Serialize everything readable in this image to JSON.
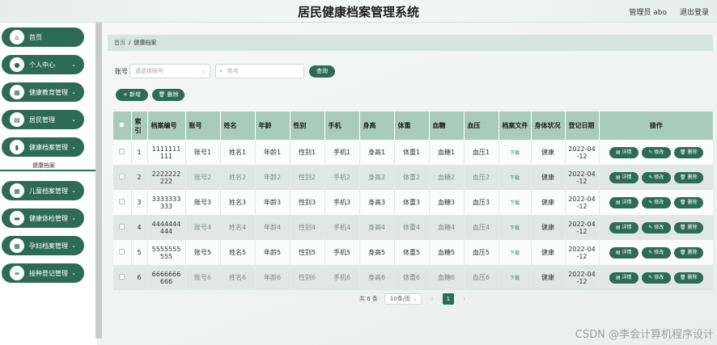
{
  "header": {
    "title": "居民健康档案管理系统",
    "user": "管理员 abo",
    "logout": "退出登录"
  },
  "sidebar": {
    "items": [
      {
        "label": "首页",
        "icon": "home-icon",
        "glyph": "⌂",
        "chevron": false
      },
      {
        "label": "个人中心",
        "icon": "user-icon",
        "glyph": "●",
        "chevron": true
      },
      {
        "label": "健康教育管理",
        "icon": "grid-icon",
        "glyph": "▦",
        "chevron": true
      },
      {
        "label": "居民管理",
        "icon": "doc-icon",
        "glyph": "▤",
        "chevron": true
      },
      {
        "label": "健康档案管理",
        "icon": "chart-icon",
        "glyph": "▮",
        "chevron": true
      },
      {
        "label": "儿童档案管理",
        "icon": "grid-icon",
        "glyph": "▦",
        "chevron": true
      },
      {
        "label": "健康体检管理",
        "icon": "card-icon",
        "glyph": "▬",
        "chevron": true
      },
      {
        "label": "孕妇档案管理",
        "icon": "grid-icon",
        "glyph": "▦",
        "chevron": true
      },
      {
        "label": "接种登记管理",
        "icon": "list-icon",
        "glyph": "≡",
        "chevron": true
      }
    ],
    "sub_item": "健康档案"
  },
  "breadcrumb": {
    "home": "首页",
    "sep": "/",
    "current": "健康档案"
  },
  "filter": {
    "label": "账号",
    "select_placeholder": "请选择账号",
    "search_placeholder": "姓名",
    "query_label": "查询"
  },
  "actions": {
    "add_label": "+ 新增",
    "delete_label": "🗑 删除"
  },
  "table": {
    "headers": [
      "索引",
      "档案编号",
      "账号",
      "姓名",
      "年龄",
      "性别",
      "手机",
      "身高",
      "体重",
      "血糖",
      "血压",
      "档案文件",
      "身体状况",
      "登记日期",
      "操作"
    ],
    "rows": [
      {
        "idx": "1",
        "no": "1111111111",
        "account": "账号1",
        "name": "姓名1",
        "age": "年龄1",
        "gender": "性别1",
        "phone": "手机1",
        "height": "身高1",
        "weight": "体重1",
        "sugar": "血糖1",
        "pressure": "血压1",
        "file": "下载",
        "health": "健康",
        "date": "2022-04-12"
      },
      {
        "idx": "2",
        "no": "2222222222",
        "account": "账号2",
        "name": "姓名2",
        "age": "年龄2",
        "gender": "性别2",
        "phone": "手机2",
        "height": "身高2",
        "weight": "体重2",
        "sugar": "血糖2",
        "pressure": "血压2",
        "file": "下载",
        "health": "健康",
        "date": "2022-04-12"
      },
      {
        "idx": "3",
        "no": "3333333333",
        "account": "账号3",
        "name": "姓名3",
        "age": "年龄3",
        "gender": "性别3",
        "phone": "手机3",
        "height": "身高3",
        "weight": "体重3",
        "sugar": "血糖3",
        "pressure": "血压3",
        "file": "下载",
        "health": "健康",
        "date": "2022-04-12"
      },
      {
        "idx": "4",
        "no": "4444444444",
        "account": "账号4",
        "name": "姓名4",
        "age": "年龄4",
        "gender": "性别4",
        "phone": "手机4",
        "height": "身高4",
        "weight": "体重4",
        "sugar": "血糖4",
        "pressure": "血压4",
        "file": "下载",
        "health": "健康",
        "date": "2022-04-12"
      },
      {
        "idx": "5",
        "no": "5555555555",
        "account": "账号5",
        "name": "姓名5",
        "age": "年龄5",
        "gender": "性别5",
        "phone": "手机5",
        "height": "身高5",
        "weight": "体重5",
        "sugar": "血糖5",
        "pressure": "血压5",
        "file": "下载",
        "health": "健康",
        "date": "2022-04-12"
      },
      {
        "idx": "6",
        "no": "6666666666",
        "account": "账号6",
        "name": "姓名6",
        "age": "年龄6",
        "gender": "性别6",
        "phone": "手机6",
        "height": "身高6",
        "weight": "体重6",
        "sugar": "血糖6",
        "pressure": "血压6",
        "file": "下载",
        "health": "健康",
        "date": "2022-04-12"
      }
    ],
    "row_actions": {
      "detail": "▤ 详情",
      "edit": "✎ 修改",
      "delete": "🗑 删除"
    }
  },
  "pagination": {
    "total": "共 6 条",
    "page_size": "10条/页",
    "prev": "‹",
    "current_page": "1",
    "next": "›"
  },
  "watermark": "CSDN @李会计算机程序设计",
  "colors": {
    "primary": "#2e6b57",
    "header_bg": "#a9cbbe",
    "stripe": "#dfe8e5"
  }
}
